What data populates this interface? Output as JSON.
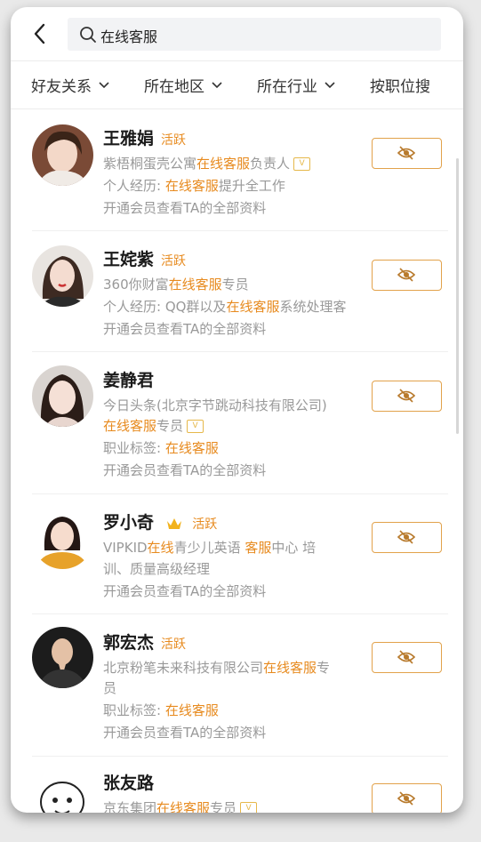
{
  "search": {
    "value": "在线客服"
  },
  "filters": [
    {
      "label": "好友关系"
    },
    {
      "label": "所在地区"
    },
    {
      "label": "所在行业"
    },
    {
      "label": "按职位搜"
    }
  ],
  "icons": {
    "back": "chevron-left-icon",
    "search": "search-icon",
    "eye": "eye-slash-icon",
    "vip": "vip-badge-icon",
    "crown": "crown-icon"
  },
  "colors": {
    "accent": "#e78a1e",
    "muted": "#999999",
    "border": "#e2a24b"
  },
  "vip_badge": "V",
  "people": [
    {
      "name": "王雅娟",
      "status": "活跃",
      "line1_pre": "紫梧桐蛋壳公寓",
      "line1_hl": "在线客服",
      "line1_post": "负责人",
      "line2_pre": "个人经历: ",
      "line2_hl": "在线客服",
      "line2_post": "提升全工作",
      "line3": "开通会员查看TA的全部资料"
    },
    {
      "name": "王姹紫",
      "status": "活跃",
      "line1_pre": "360你财富",
      "line1_hl": "在线客服",
      "line1_post": "专员",
      "line2_pre": "个人经历: QQ群以及",
      "line2_hl": "在线客服",
      "line2_post": "系统处理客",
      "line3": "开通会员查看TA的全部资料"
    },
    {
      "name": "姜静君",
      "status": "",
      "line1": "今日头条(北京字节跳动科技有限公司)",
      "line2_hl": "在线客服",
      "line2_post": "专员",
      "line3_pre": "职业标签: ",
      "line3_hl": "在线客服",
      "line4": "开通会员查看TA的全部资料"
    },
    {
      "name": "罗小奇",
      "status": "活跃",
      "line1_pre": "VIPKID",
      "line1_hl": "在线",
      "line1_mid": "青少儿英语 ",
      "line1_hl2": "客服",
      "line1_post": "中心 培",
      "line2": "训、质量高级经理",
      "line3": "开通会员查看TA的全部资料"
    },
    {
      "name": "郭宏杰",
      "status": "活跃",
      "line1_pre": "北京粉笔未来科技有限公司",
      "line1_hl": "在线客服",
      "line1_post": "专",
      "line2": "员",
      "line3_pre": "职业标签: ",
      "line3_hl": "在线客服",
      "line4": "开通会员查看TA的全部资料"
    },
    {
      "name": "张友路",
      "status": "",
      "line1_pre": "京东集团",
      "line1_hl": "在线客服",
      "line1_post": "专员"
    }
  ]
}
